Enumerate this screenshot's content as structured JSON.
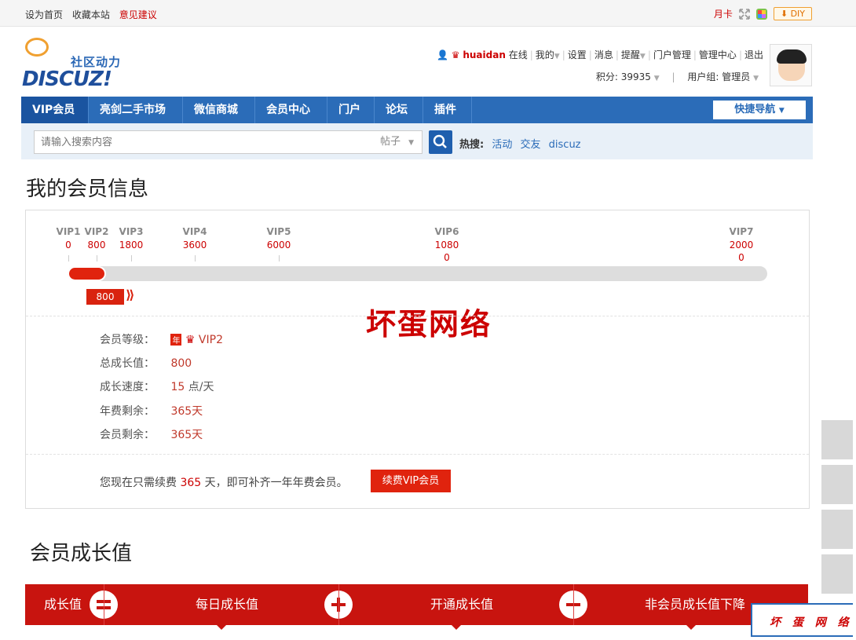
{
  "topbar": {
    "links": [
      "设为首页",
      "收藏本站"
    ],
    "feedback": "意见建议",
    "yueka": "月卡",
    "diy": "DIY"
  },
  "logo": {
    "sub": "社区动力",
    "main": "DISCUZ!"
  },
  "user": {
    "name": "huaidan",
    "status": "在线",
    "menu": [
      "我的",
      "设置",
      "消息",
      "提醒",
      "门户管理",
      "管理中心",
      "退出"
    ],
    "points_label": "积分: 39935",
    "group_label": "用户组: 管理员"
  },
  "nav": {
    "items": [
      "VIP会员",
      "亮剑二手市场",
      "微信商城",
      "会员中心",
      "门户",
      "论坛",
      "插件"
    ],
    "quick": "快捷导航"
  },
  "search": {
    "placeholder": "请输入搜索内容",
    "type": "帖子",
    "hot_label": "热搜:",
    "hot": [
      "活动",
      "交友",
      "discuz"
    ]
  },
  "member_info": {
    "title": "我的会员信息",
    "levels": [
      {
        "name": "VIP1",
        "value": "0"
      },
      {
        "name": "VIP2",
        "value": "800"
      },
      {
        "name": "VIP3",
        "value": "1800"
      },
      {
        "name": "VIP4",
        "value": "3600"
      },
      {
        "name": "VIP5",
        "value": "6000"
      },
      {
        "name": "VIP6",
        "value": "1080",
        "value2": "0"
      },
      {
        "name": "VIP7",
        "value": "2000",
        "value2": "0"
      }
    ],
    "progress": 0.055,
    "current": "800",
    "watermark": "坏蛋网络",
    "rows": [
      {
        "label": "会员等级：",
        "value": "VIP2",
        "unit": ""
      },
      {
        "label": "总成长值：",
        "value": "800",
        "unit": ""
      },
      {
        "label": "成长速度：",
        "value": "15",
        "unit": "点/天"
      },
      {
        "label": "年费剩余：",
        "value": "365天",
        "unit": ""
      },
      {
        "label": "会员剩余：",
        "value": "365天",
        "unit": ""
      }
    ],
    "renew_pre": "您现在只需续费",
    "renew_days": "365",
    "renew_post": "天，即可补齐一年年费会员。",
    "renew_button": "续费VIP会员"
  },
  "growth": {
    "title": "会员成长值",
    "cells": [
      "成长值",
      "每日成长值",
      "开通成长值",
      "非会员成长值下降"
    ]
  },
  "brand_corner": "坏 蛋 网 络",
  "colors": {
    "nav": "#2b6cb8",
    "accent": "#e0230e",
    "growth": "#c8140f"
  }
}
